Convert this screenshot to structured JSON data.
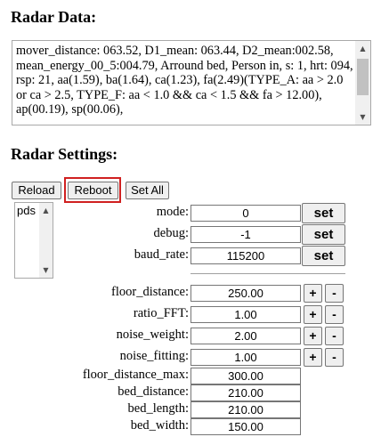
{
  "radar": {
    "title": "Radar Data:",
    "text": "mover_distance: 063.52, D1_mean: 063.44, D2_mean:002.58, mean_energy_00_5:004.79, Arround bed, Person in, s: 1, hrt: 094, rsp: 21, aa(1.59), ba(1.64), ca(1.23), fa(2.49)(TYPE_A: aa > 2.0 or ca > 2.5, TYPE_F: aa < 1.0 && ca < 1.5 && fa > 12.00), ap(00.19), sp(00.06),"
  },
  "settings": {
    "title": "Radar Settings:",
    "reload_label": "Reload",
    "reboot_label": "Reboot",
    "setall_label": "Set All",
    "list_item": "pds",
    "set_label": "set",
    "plus_label": "+",
    "minus_label": "-",
    "fields": [
      {
        "label": "mode:",
        "value": "0"
      },
      {
        "label": "debug:",
        "value": "-1"
      },
      {
        "label": "baud_rate:",
        "value": "115200"
      },
      {
        "label": "floor_distance:",
        "value": "250.00"
      },
      {
        "label": "ratio_FFT:",
        "value": "1.00"
      },
      {
        "label": "noise_weight:",
        "value": "2.00"
      },
      {
        "label": "noise_fitting:",
        "value": "1.00"
      },
      {
        "label": "floor_distance_max:",
        "value": "300.00"
      },
      {
        "label": "bed_distance:",
        "value": "210.00"
      },
      {
        "label": "bed_length:",
        "value": "210.00"
      },
      {
        "label": "bed_width:",
        "value": "150.00"
      }
    ]
  },
  "icons": {
    "scroll_up": "triangle-up",
    "scroll_down": "triangle-down"
  },
  "colors": {
    "highlight": "#d02020",
    "button_bg": "#efefef"
  }
}
